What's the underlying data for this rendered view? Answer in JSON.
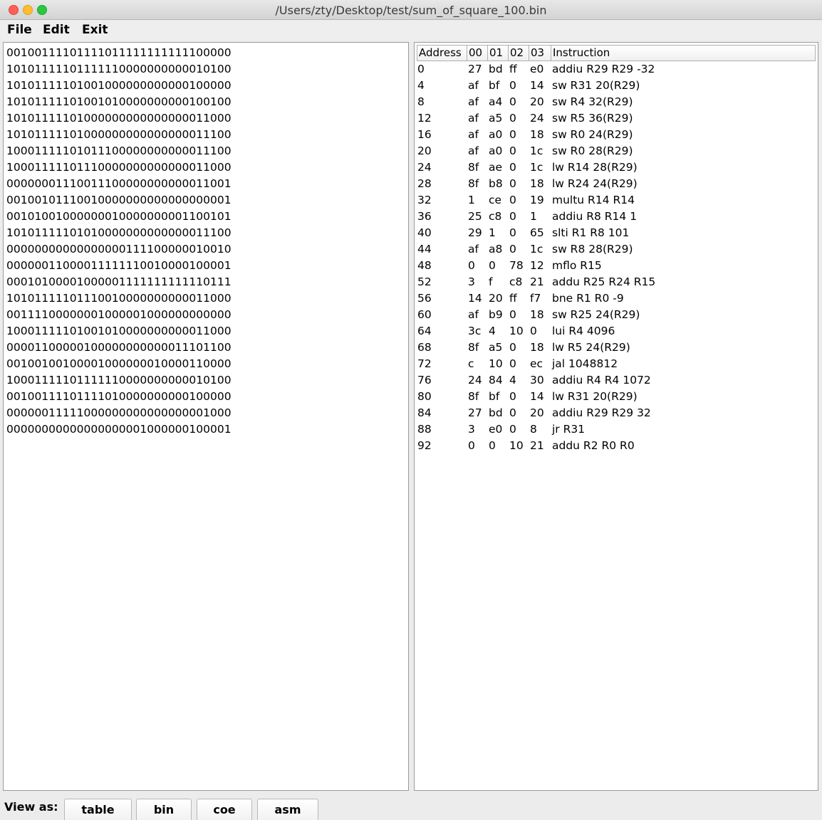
{
  "window": {
    "title": "/Users/zty/Desktop/test/sum_of_square_100.bin"
  },
  "menu": [
    "File",
    "Edit",
    "Exit"
  ],
  "bin_lines": [
    "00100111101111011111111111100000",
    "10101111101111110000000000010100",
    "10101111101001000000000000100000",
    "10101111101001010000000000100100",
    "10101111101000000000000000011000",
    "10101111101000000000000000011100",
    "10001111101011100000000000011100",
    "10001111101110000000000000011000",
    "00000001110011100000000000011001",
    "00100101110010000000000000000001",
    "00101001000000010000000001100101",
    "10101111101010000000000000011100",
    "00000000000000000111100000010010",
    "00000011000011111110010000100001",
    "00010100001000001111111111110111",
    "10101111101110010000000000011000",
    "00111100000001000001000000000000",
    "10001111101001010000000000011000",
    "00001100000100000000000011101100",
    "00100100100001000000010000110000",
    "10001111101111110000000000010100",
    "00100111101111010000000000100000",
    "00000011111000000000000000001000",
    "00000000000000000001000000100001"
  ],
  "table": {
    "headers": [
      "Address",
      "00",
      "01",
      "02",
      "03",
      "Instruction"
    ],
    "rows": [
      {
        "address": "0",
        "bytes": [
          "27",
          "bd",
          "ff",
          "e0"
        ],
        "instruction": "addiu R29 R29 -32"
      },
      {
        "address": "4",
        "bytes": [
          "af",
          "bf",
          "0",
          "14"
        ],
        "instruction": "sw R31 20(R29)"
      },
      {
        "address": "8",
        "bytes": [
          "af",
          "a4",
          "0",
          "20"
        ],
        "instruction": "sw R4 32(R29)"
      },
      {
        "address": "12",
        "bytes": [
          "af",
          "a5",
          "0",
          "24"
        ],
        "instruction": "sw R5 36(R29)"
      },
      {
        "address": "16",
        "bytes": [
          "af",
          "a0",
          "0",
          "18"
        ],
        "instruction": "sw R0 24(R29)"
      },
      {
        "address": "20",
        "bytes": [
          "af",
          "a0",
          "0",
          "1c"
        ],
        "instruction": "sw R0 28(R29)"
      },
      {
        "address": "24",
        "bytes": [
          "8f",
          "ae",
          "0",
          "1c"
        ],
        "instruction": "lw R14 28(R29)"
      },
      {
        "address": "28",
        "bytes": [
          "8f",
          "b8",
          "0",
          "18"
        ],
        "instruction": "lw R24 24(R29)"
      },
      {
        "address": "32",
        "bytes": [
          "1",
          "ce",
          "0",
          "19"
        ],
        "instruction": "multu R14 R14"
      },
      {
        "address": "36",
        "bytes": [
          "25",
          "c8",
          "0",
          "1"
        ],
        "instruction": "addiu R8 R14 1"
      },
      {
        "address": "40",
        "bytes": [
          "29",
          "1",
          "0",
          "65"
        ],
        "instruction": "slti R1 R8 101"
      },
      {
        "address": "44",
        "bytes": [
          "af",
          "a8",
          "0",
          "1c"
        ],
        "instruction": "sw R8 28(R29)"
      },
      {
        "address": "48",
        "bytes": [
          "0",
          "0",
          "78",
          "12"
        ],
        "instruction": "mflo R15"
      },
      {
        "address": "52",
        "bytes": [
          "3",
          "f",
          "c8",
          "21"
        ],
        "instruction": "addu R25 R24 R15"
      },
      {
        "address": "56",
        "bytes": [
          "14",
          "20",
          "ff",
          "f7"
        ],
        "instruction": "bne R1 R0 -9"
      },
      {
        "address": "60",
        "bytes": [
          "af",
          "b9",
          "0",
          "18"
        ],
        "instruction": "sw R25 24(R29)"
      },
      {
        "address": "64",
        "bytes": [
          "3c",
          "4",
          "10",
          "0"
        ],
        "instruction": "lui R4 4096"
      },
      {
        "address": "68",
        "bytes": [
          "8f",
          "a5",
          "0",
          "18"
        ],
        "instruction": "lw R5 24(R29)"
      },
      {
        "address": "72",
        "bytes": [
          "c",
          "10",
          "0",
          "ec"
        ],
        "instruction": "jal 1048812"
      },
      {
        "address": "76",
        "bytes": [
          "24",
          "84",
          "4",
          "30"
        ],
        "instruction": "addiu R4 R4 1072"
      },
      {
        "address": "80",
        "bytes": [
          "8f",
          "bf",
          "0",
          "14"
        ],
        "instruction": "lw R31 20(R29)"
      },
      {
        "address": "84",
        "bytes": [
          "27",
          "bd",
          "0",
          "20"
        ],
        "instruction": "addiu R29 R29 32"
      },
      {
        "address": "88",
        "bytes": [
          "3",
          "e0",
          "0",
          "8"
        ],
        "instruction": "jr R31"
      },
      {
        "address": "92",
        "bytes": [
          "0",
          "0",
          "10",
          "21"
        ],
        "instruction": "addu R2 R0 R0"
      }
    ]
  },
  "bottom": {
    "label": "View as:",
    "buttons": [
      "table",
      "bin",
      "coe",
      "asm"
    ]
  }
}
